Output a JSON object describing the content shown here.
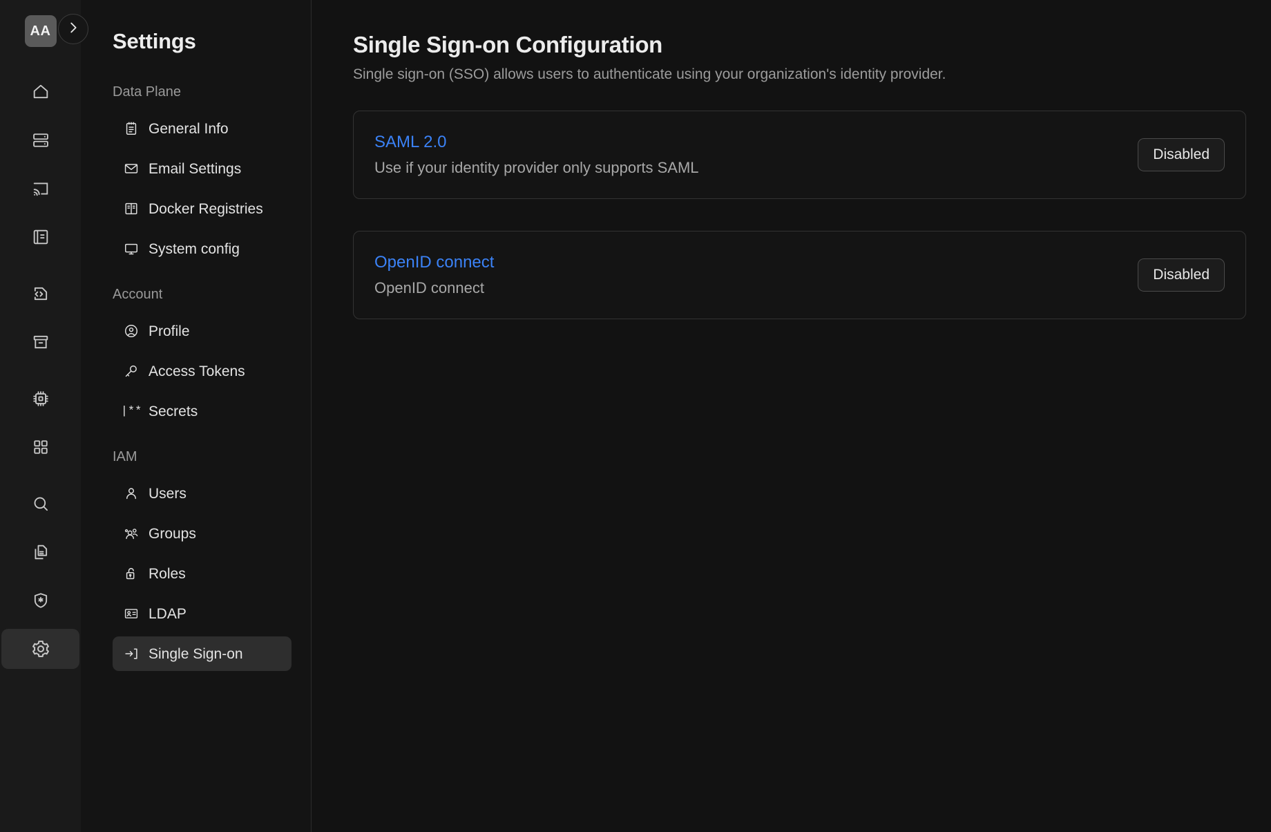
{
  "rail": {
    "logo_label": "AA",
    "collapse_icon": "chevron-right-icon",
    "items": [
      {
        "name": "home-icon"
      },
      {
        "name": "server-icon"
      },
      {
        "name": "cast-icon"
      },
      {
        "name": "notebook-icon"
      },
      {
        "name": "code-file-icon"
      },
      {
        "name": "archive-icon"
      },
      {
        "name": "cpu-icon"
      },
      {
        "name": "grid-apps-icon"
      },
      {
        "name": "search-icon"
      },
      {
        "name": "documents-icon"
      },
      {
        "name": "shield-star-icon"
      },
      {
        "name": "gear-icon"
      }
    ]
  },
  "sidebar": {
    "title": "Settings",
    "groups": [
      {
        "label": "Data Plane",
        "items": [
          {
            "label": "General Info",
            "icon": "notepad-icon"
          },
          {
            "label": "Email Settings",
            "icon": "envelope-icon"
          },
          {
            "label": "Docker Registries",
            "icon": "registry-icon"
          },
          {
            "label": "System config",
            "icon": "monitor-icon"
          }
        ]
      },
      {
        "label": "Account",
        "items": [
          {
            "label": "Profile",
            "icon": "user-circle-icon"
          },
          {
            "label": "Access Tokens",
            "icon": "key-icon"
          },
          {
            "label": "Secrets",
            "icon": "password-mask-icon",
            "glyph": "|**"
          }
        ]
      },
      {
        "label": "IAM",
        "items": [
          {
            "label": "Users",
            "icon": "user-icon"
          },
          {
            "label": "Groups",
            "icon": "users-group-icon"
          },
          {
            "label": "Roles",
            "icon": "unlocked-padlock-icon"
          },
          {
            "label": "LDAP",
            "icon": "contact-card-icon"
          },
          {
            "label": "Single Sign-on",
            "icon": "login-arrow-icon",
            "selected": true
          }
        ]
      }
    ]
  },
  "main": {
    "title": "Single Sign-on Configuration",
    "subtitle": "Single sign-on (SSO) allows users to authenticate using your organization's identity provider.",
    "cards": [
      {
        "title": "SAML 2.0",
        "description": "Use if your identity provider only supports SAML",
        "status": "Disabled"
      },
      {
        "title": "OpenID connect",
        "description": "OpenID connect",
        "status": "Disabled"
      }
    ]
  },
  "colors": {
    "link": "#3b82f6",
    "background": "#121212",
    "rail_background": "#1a1a1a",
    "sidebar_background": "#141414",
    "selected": "#2e2e2e"
  }
}
